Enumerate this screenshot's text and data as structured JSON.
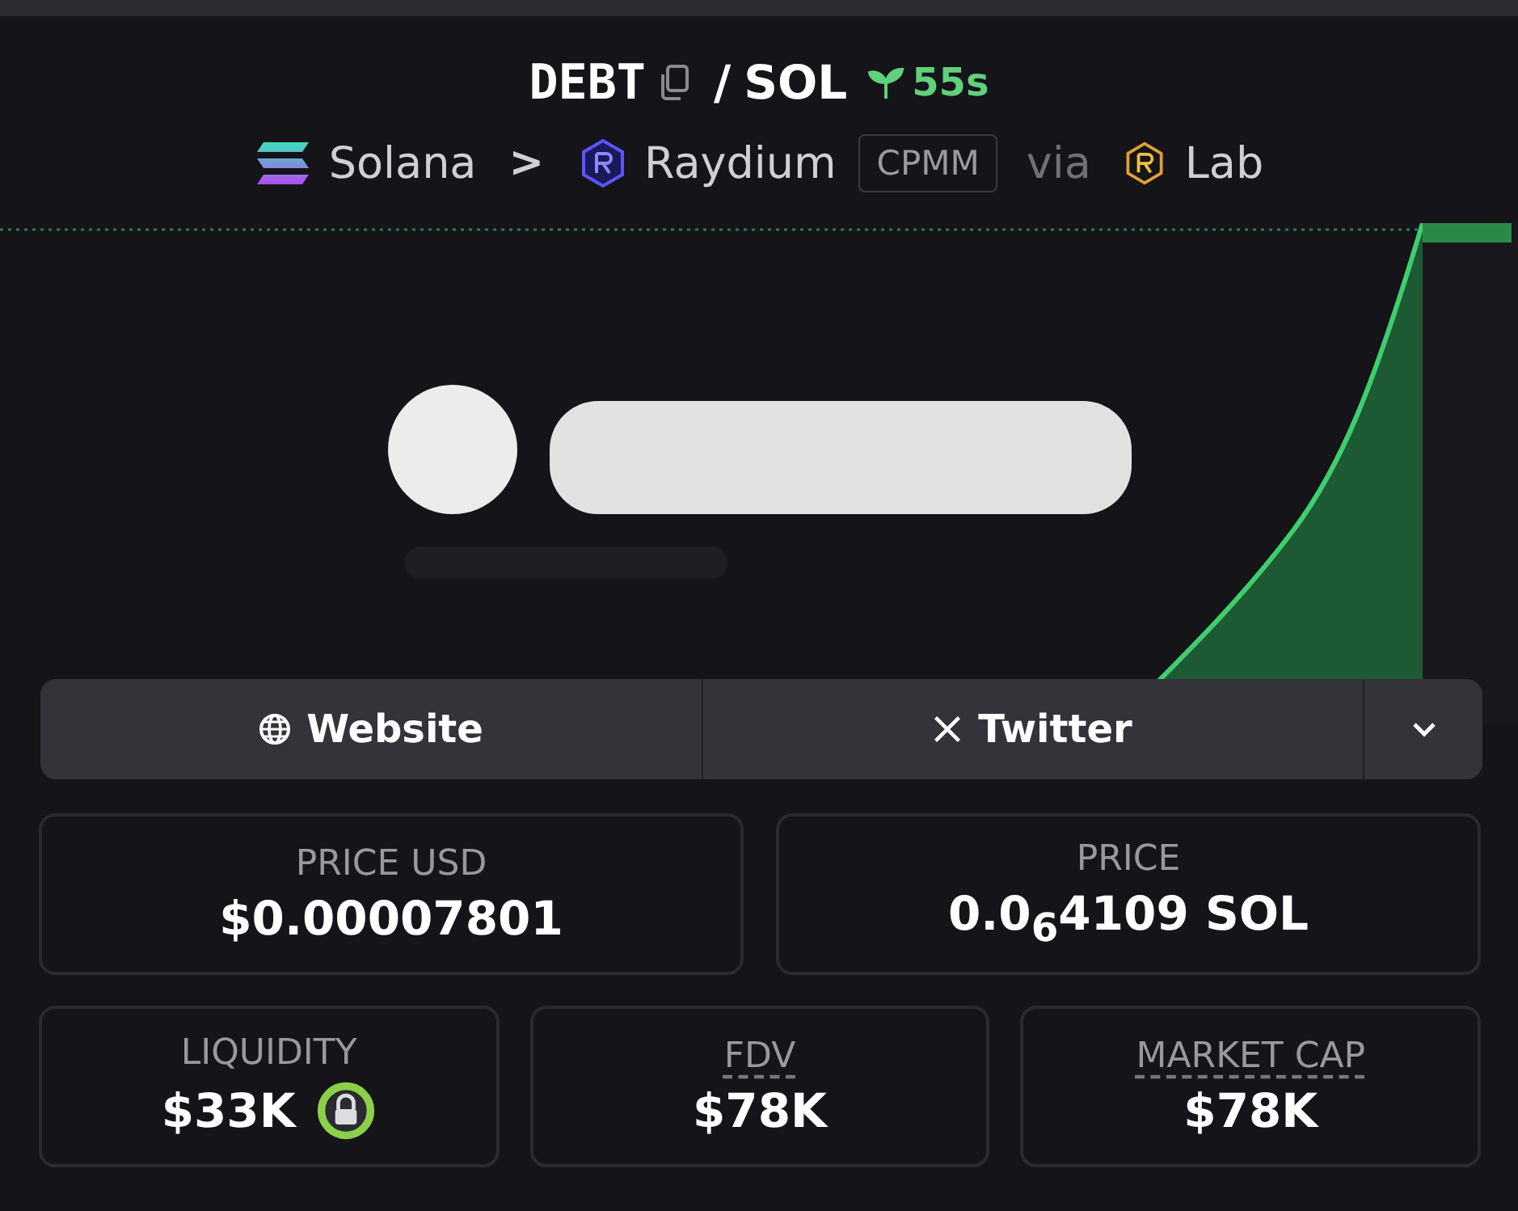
{
  "header": {
    "base": "DEBT",
    "pair_separator": "/",
    "quote": "SOL",
    "age": "55s",
    "chain": "Solana",
    "separator": ">",
    "dex": "Raydium",
    "pool_type": "CPMM",
    "via": "via",
    "launchpad": "Lab"
  },
  "links": [
    {
      "kind": "website",
      "label": "Website"
    },
    {
      "kind": "twitter",
      "label": "Twitter"
    },
    {
      "kind": "more"
    }
  ],
  "stats_top": [
    {
      "label": "PRICE USD",
      "value": "$0.00007801",
      "underlined": false,
      "locked": false
    },
    {
      "label": "PRICE",
      "value": "0.0$_{6}$4109 SOL",
      "underlined": false,
      "locked": false
    }
  ],
  "stats_bottom": [
    {
      "label": "LIQUIDITY",
      "value": "$33K",
      "underlined": false,
      "locked": true
    },
    {
      "label": "FDV",
      "value": "$78K",
      "underlined": true,
      "locked": false
    },
    {
      "label": "MARKET CAP",
      "value": "$78K",
      "underlined": true,
      "locked": false
    }
  ]
}
